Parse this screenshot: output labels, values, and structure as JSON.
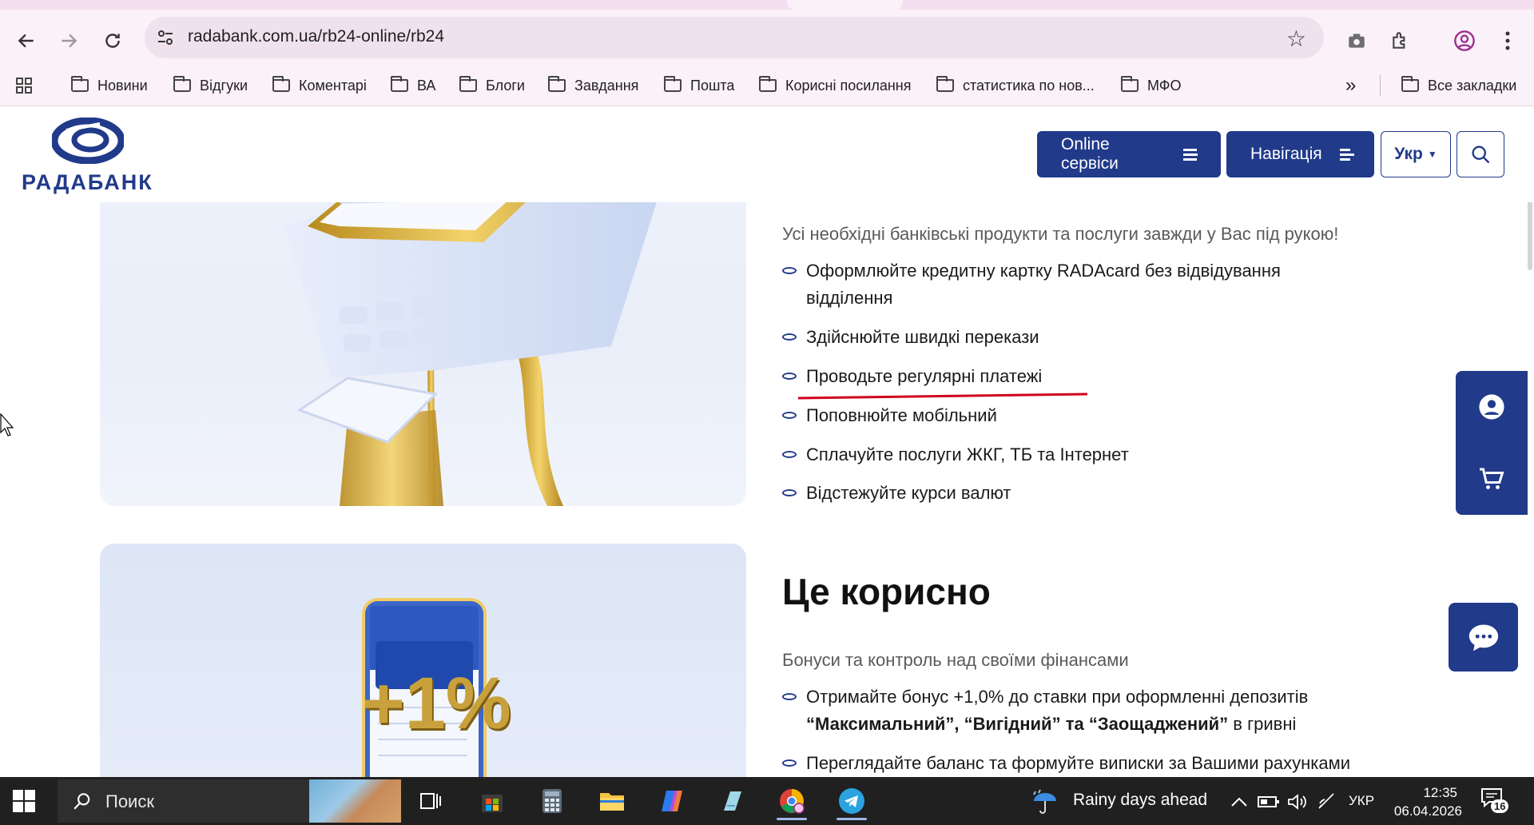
{
  "browser": {
    "url": "radabank.com.ua/rb24-online/rb24",
    "bookmarks": [
      "Новини",
      "Відгуки",
      "Коментарі",
      "ВА",
      "Блоги",
      "Завдання",
      "Пошта",
      "Корисні посилання",
      "статистика по нов...",
      "МФО"
    ],
    "more_label": "»",
    "all_bookmarks": "Все закладки"
  },
  "site": {
    "logo_text": "РАДАБАНК",
    "online_services": "Online сервіси",
    "navigation": "Навігація",
    "language": "Укр"
  },
  "section1": {
    "subtitle": "Усі необхідні банківські продукти та послуги завжди у Вас під рукою!",
    "items": [
      "Оформлюйте кредитну картку RADAcard без відвідування",
      "відділення",
      "Здійснюйте швидкі перекази",
      "Проводьте регулярні платежі",
      "Поповнюйте мобільний",
      "Сплачуйте послуги ЖКГ, ТБ та Інтернет",
      "Відстежуйте курси валют"
    ]
  },
  "section2": {
    "heading": "Це корисно",
    "subtitle": "Бонуси та контроль над своїми фінансами",
    "bonus_line1": "Отримайте бонус +1,0% до ставки при оформленні депозитів",
    "bonus_bold": "“Максимальний”, “Вигідний” та “Заощаджений”",
    "bonus_tail": " в гривні",
    "balance": "Переглядайте баланс та формуйте виписки за Вашими рахунками",
    "promo_text": "+1%"
  },
  "taskbar": {
    "search_placeholder": "Поиск",
    "weather": "Rainy days ahead",
    "language": "УКР",
    "time": "12:35",
    "date": "06.04.2026",
    "notifications": "16"
  },
  "colors": {
    "brand": "#213a8a",
    "annotation": "#d0021b"
  }
}
